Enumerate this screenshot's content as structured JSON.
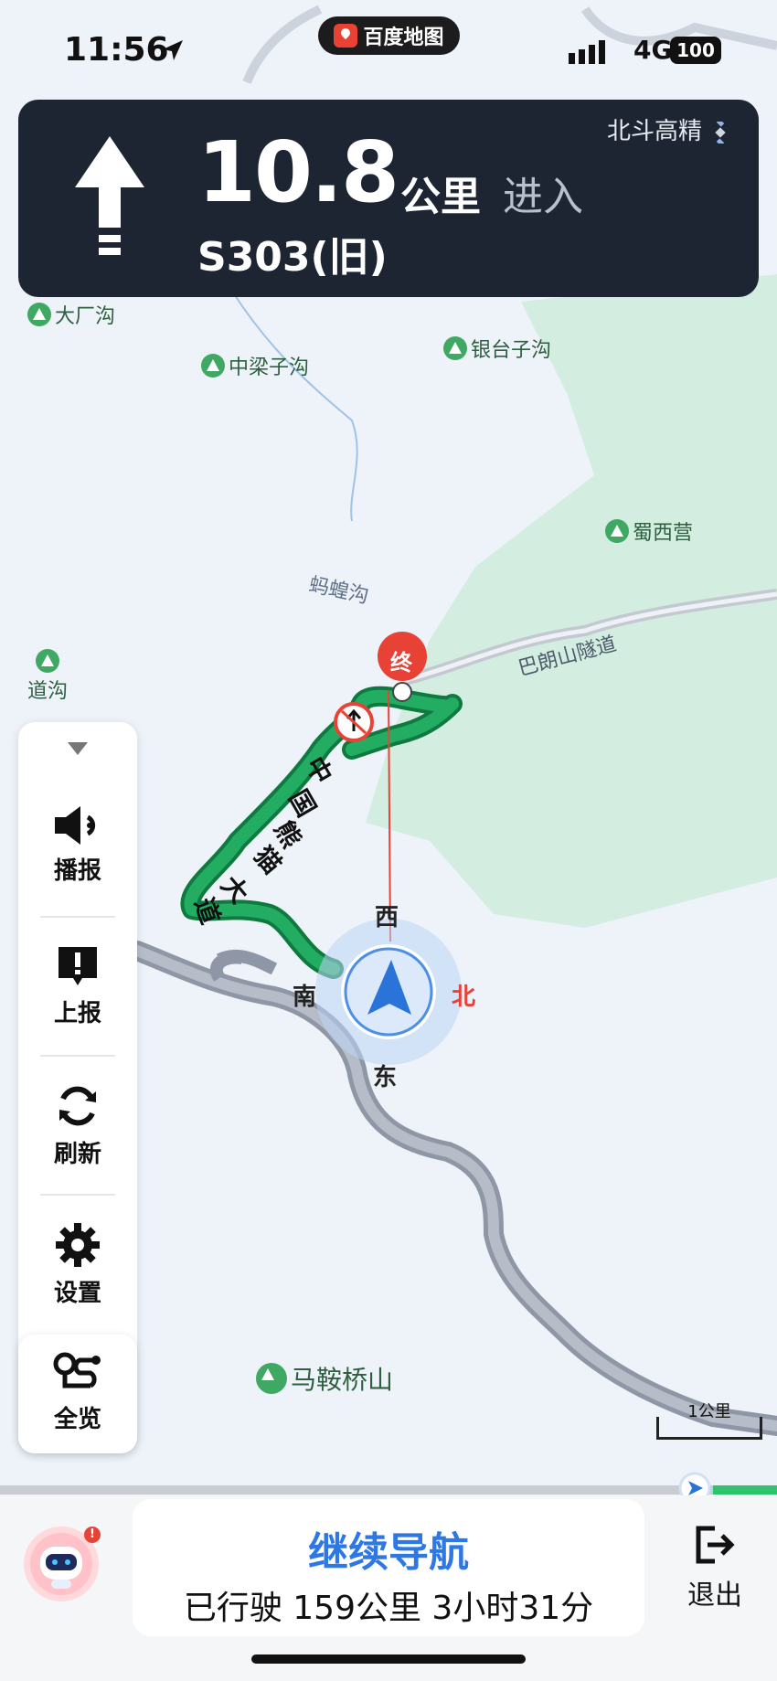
{
  "status_bar": {
    "time": "11:56",
    "network": "4G",
    "battery": "100"
  },
  "app_pill": {
    "label": "百度地图"
  },
  "guidance": {
    "distance": "10.8",
    "unit": "公里",
    "action": "进入",
    "road": "S303(旧)",
    "gps_label": "北斗高精"
  },
  "map": {
    "pois": [
      "大厂沟",
      "中梁子沟",
      "银台子沟",
      "蜀西营",
      "道沟",
      "马鞍桥山"
    ],
    "place_labels": [
      "蚂蝗沟",
      "巴朗山隧道"
    ],
    "route_label": [
      "中",
      "国",
      "熊",
      "猫",
      "大",
      "道"
    ],
    "end_marker": "终",
    "compass": {
      "west": "西",
      "south": "南",
      "north": "北",
      "east": "东"
    },
    "scale": "1公里"
  },
  "side_panel": {
    "buttons": [
      {
        "label": "播报",
        "icon": "speaker-icon"
      },
      {
        "label": "上报",
        "icon": "report-icon"
      },
      {
        "label": "刷新",
        "icon": "refresh-icon"
      },
      {
        "label": "设置",
        "icon": "gear-icon"
      }
    ],
    "overview": {
      "label": "全览",
      "icon": "route-overview-icon"
    }
  },
  "bottom_bar": {
    "continue_label": "继续导航",
    "trip_info": "已行驶 159公里 3小时31分",
    "exit_label": "退出",
    "progress": 0.92
  },
  "colors": {
    "route": "#1fa05a",
    "accent": "#2e78e6",
    "guide_bg": "#1d2533",
    "end_marker": "#e84237"
  }
}
